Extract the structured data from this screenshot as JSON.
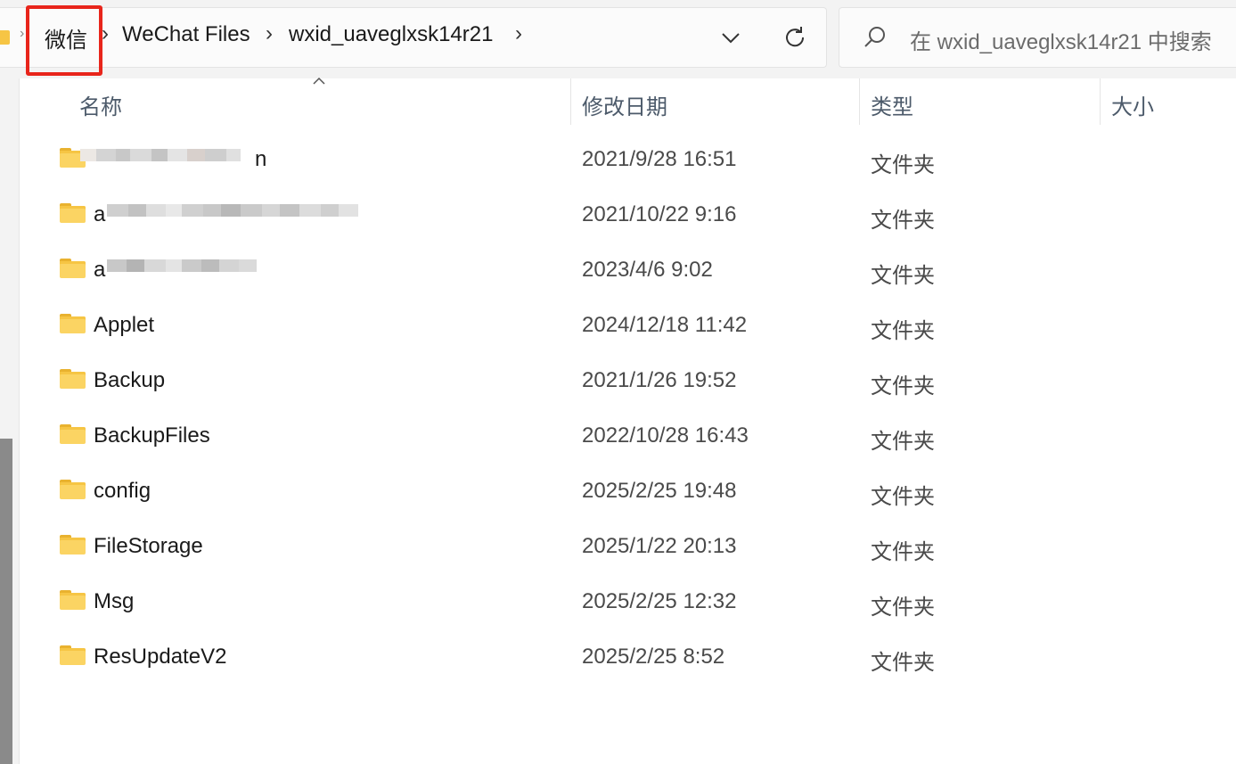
{
  "address_bar": {
    "breadcrumbs": [
      {
        "label": "微信"
      },
      {
        "label": "WeChat Files"
      },
      {
        "label": "wxid_uaveglxsk14r21"
      }
    ],
    "separator": "›"
  },
  "search": {
    "placeholder": "在 wxid_uaveglxsk14r21 中搜索"
  },
  "columns": {
    "name": "名称",
    "modified": "修改日期",
    "type": "类型",
    "size": "大小"
  },
  "files": [
    {
      "name": "",
      "name_suffix": "n",
      "modified": "2021/9/28 16:51",
      "type": "文件夹",
      "redacted": true
    },
    {
      "name": "a",
      "name_suffix": "",
      "modified": "2021/10/22 9:16",
      "type": "文件夹",
      "redacted": true
    },
    {
      "name": "a",
      "name_suffix": "",
      "modified": "2023/4/6 9:02",
      "type": "文件夹",
      "redacted": true
    },
    {
      "name": "Applet",
      "modified": "2024/12/18 11:42",
      "type": "文件夹"
    },
    {
      "name": "Backup",
      "modified": "2021/1/26 19:52",
      "type": "文件夹"
    },
    {
      "name": "BackupFiles",
      "modified": "2022/10/28 16:43",
      "type": "文件夹"
    },
    {
      "name": "config",
      "modified": "2025/2/25 19:48",
      "type": "文件夹"
    },
    {
      "name": "FileStorage",
      "modified": "2025/1/22 20:13",
      "type": "文件夹"
    },
    {
      "name": "Msg",
      "modified": "2025/2/25 12:32",
      "type": "文件夹"
    },
    {
      "name": "ResUpdateV2",
      "modified": "2025/2/25 8:52",
      "type": "文件夹"
    }
  ],
  "colors": {
    "highlight": "#e8251b",
    "folder": "#fbd463",
    "header_text": "#4c5a6a"
  },
  "icons": [
    "folder-icon",
    "chevron-down-icon",
    "refresh-icon",
    "search-icon",
    "sort-ascending-icon"
  ]
}
